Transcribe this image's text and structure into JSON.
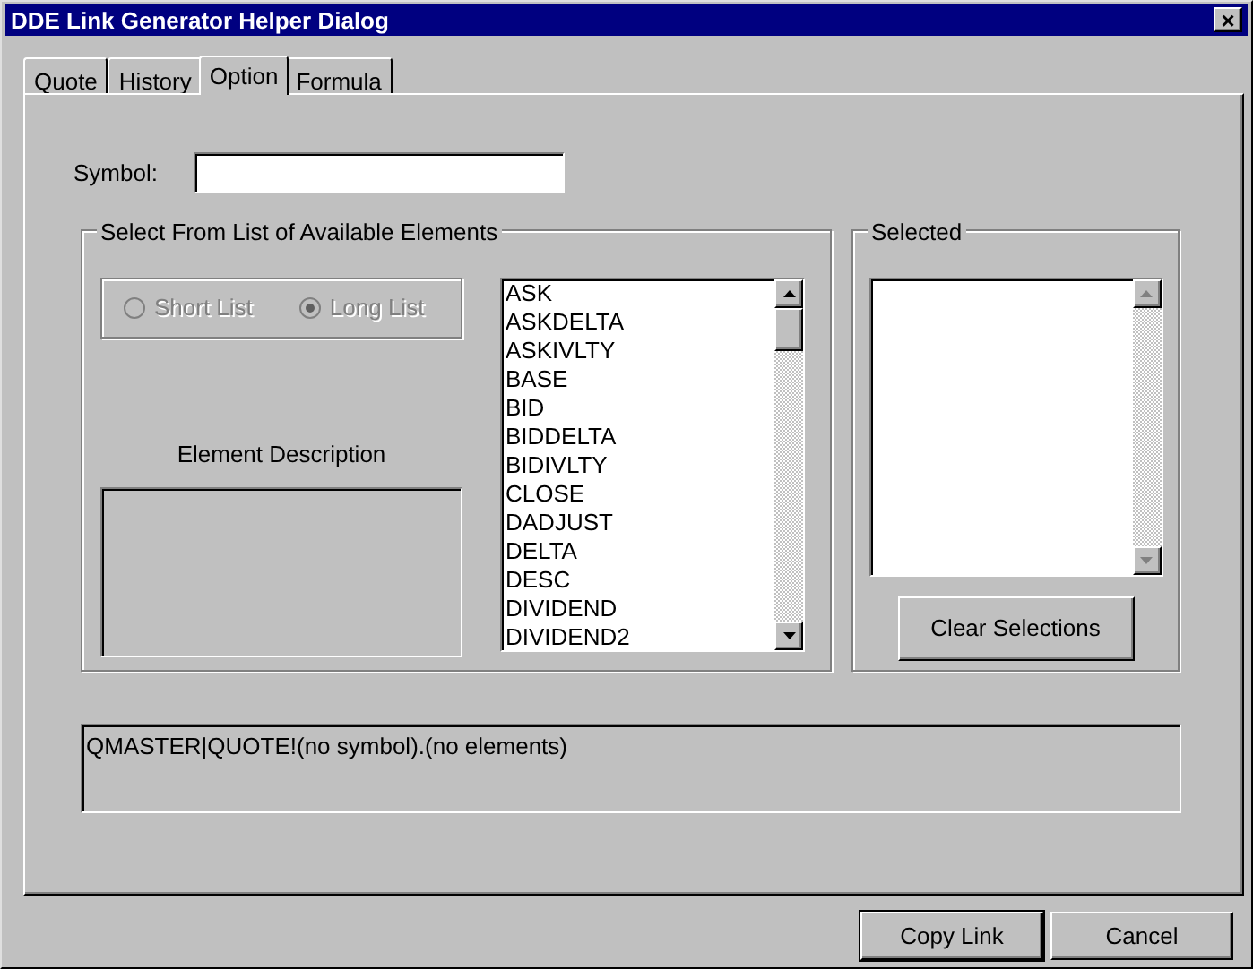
{
  "window": {
    "title": "DDE Link Generator Helper Dialog",
    "close": "×"
  },
  "tabs": [
    {
      "label": "Quote",
      "selected": false
    },
    {
      "label": "History",
      "selected": false
    },
    {
      "label": "Option",
      "selected": true
    },
    {
      "label": "Formula",
      "selected": false
    }
  ],
  "symbol": {
    "label": "Symbol:"
  },
  "elements_group": {
    "title": "Select From List of Available Elements",
    "radios": [
      {
        "label": "Short List",
        "selected": false,
        "disabled": true
      },
      {
        "label": "Long List",
        "selected": true,
        "disabled": true
      }
    ],
    "description_label": "Element Description",
    "list": [
      "ASK",
      "ASKDELTA",
      "ASKIVLTY",
      "BASE",
      "BID",
      "BIDDELTA",
      "BIDIVLTY",
      "CLOSE",
      "DADJUST",
      "DELTA",
      "DESC",
      "DIVIDEND",
      "DIVIDEND2"
    ]
  },
  "selected_group": {
    "title": "Selected",
    "button": "Clear Selections"
  },
  "link_text": "QMASTER|QUOTE!(no symbol).(no elements)",
  "buttons": [
    "Copy Link",
    "Cancel"
  ]
}
